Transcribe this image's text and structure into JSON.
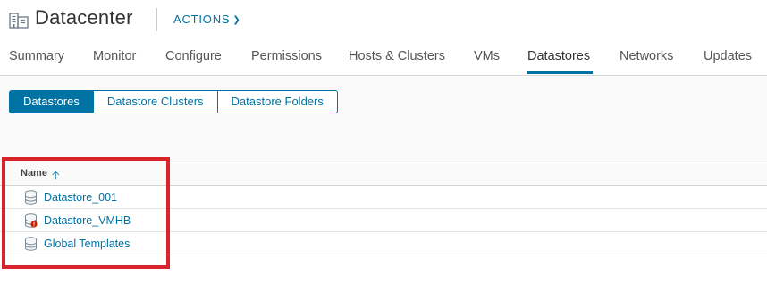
{
  "header": {
    "icon": "datacenter-icon",
    "title": "Datacenter",
    "actions_label": "ACTIONS",
    "actions_icon": "chevron-down-icon"
  },
  "tabs": [
    {
      "label": "Summary",
      "active": false
    },
    {
      "label": "Monitor",
      "active": false
    },
    {
      "label": "Configure",
      "active": false
    },
    {
      "label": "Permissions",
      "active": false
    },
    {
      "label": "Hosts & Clusters",
      "active": false
    },
    {
      "label": "VMs",
      "active": false
    },
    {
      "label": "Datastores",
      "active": true
    },
    {
      "label": "Networks",
      "active": false
    },
    {
      "label": "Updates",
      "active": false
    }
  ],
  "subtabs": [
    {
      "label": "Datastores",
      "active": true
    },
    {
      "label": "Datastore Clusters",
      "active": false
    },
    {
      "label": "Datastore Folders",
      "active": false
    }
  ],
  "grid": {
    "columns": [
      {
        "label": "Name",
        "sort": "ascending",
        "sort_icon": "sort-ascending-icon"
      }
    ],
    "rows": [
      {
        "name": "Datastore_001",
        "icon": "datastore-icon",
        "status": "normal"
      },
      {
        "name": "Datastore_VMHB",
        "icon": "datastore-alert-icon",
        "status": "alert"
      },
      {
        "name": "Global Templates",
        "icon": "datastore-icon",
        "status": "normal"
      }
    ]
  },
  "colors": {
    "accent": "#0072a3",
    "highlight_box": "#d8232a",
    "alert": "#c92100"
  }
}
